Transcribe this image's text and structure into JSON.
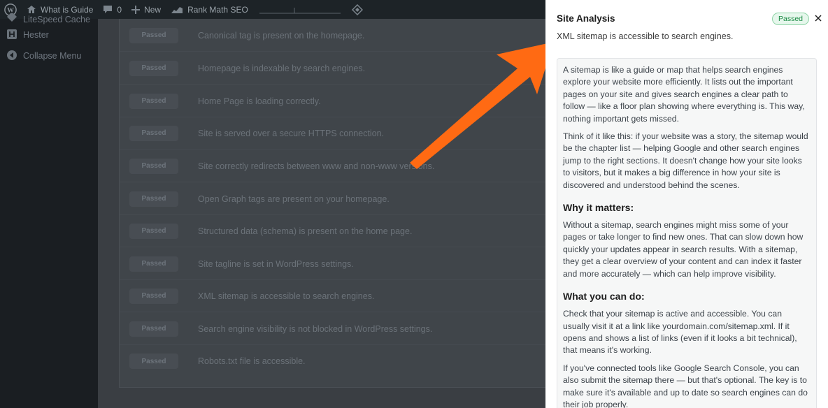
{
  "adminbar": {
    "site_name": "What is Guide",
    "comments_count": "0",
    "new_label": "New",
    "rank_math_label": "Rank Math SEO"
  },
  "sidemenu": {
    "items": [
      {
        "label": "LiteSpeed Cache",
        "icon": "litespeed-icon"
      },
      {
        "label": "Hester",
        "icon": "hester-icon"
      },
      {
        "label": "Collapse Menu",
        "icon": "collapse-icon"
      }
    ]
  },
  "checks": {
    "badge_label": "Passed",
    "items": [
      "Canonical tag is present on the homepage.",
      "Homepage is indexable by search engines.",
      "Home Page is loading correctly.",
      "Site is served over a secure HTTPS connection.",
      "Site correctly redirects between www and non-www versions.",
      "Open Graph tags are present on your homepage.",
      "Structured data (schema) is present on the home page.",
      "Site tagline is set in WordPress settings.",
      "XML sitemap is accessible to search engines.",
      "Search engine visibility is not blocked in WordPress settings.",
      "Robots.txt file is accessible."
    ]
  },
  "drawer": {
    "title": "Site Analysis",
    "status": "Passed",
    "subtitle": "XML sitemap is accessible to search engines.",
    "p1": "A sitemap is like a guide or map that helps search engines explore your website more efficiently. It lists out the important pages on your site and gives search engines a clear path to follow — like a floor plan showing where everything is. This way, nothing important gets missed.",
    "p2": "Think of it like this: if your website was a story, the sitemap would be the chapter list — helping Google and other search engines jump to the right sections. It doesn't change how your site looks to visitors, but it makes a big difference in how your site is discovered and understood behind the scenes.",
    "h1": "Why it matters:",
    "p3": "Without a sitemap, search engines might miss some of your pages or take longer to find new ones. That can slow down how quickly your updates appear in search results. With a sitemap, they get a clear overview of your content and can index it faster and more accurately — which can help improve visibility.",
    "h2": "What you can do:",
    "p4": "Check that your sitemap is active and accessible. You can usually visit it at a link like yourdomain.com/sitemap.xml. If it opens and shows a list of links (even if it looks a bit technical), that means it's working.",
    "p5": "If you've connected tools like Google Search Console, you can also submit the sitemap there — but that's optional. The key is to make sure it's available and up to date so search engines can do their job properly."
  },
  "colors": {
    "arrow": "#ff6a13",
    "passed_green": "#1a8a43",
    "overlay": "#3a3e43"
  }
}
